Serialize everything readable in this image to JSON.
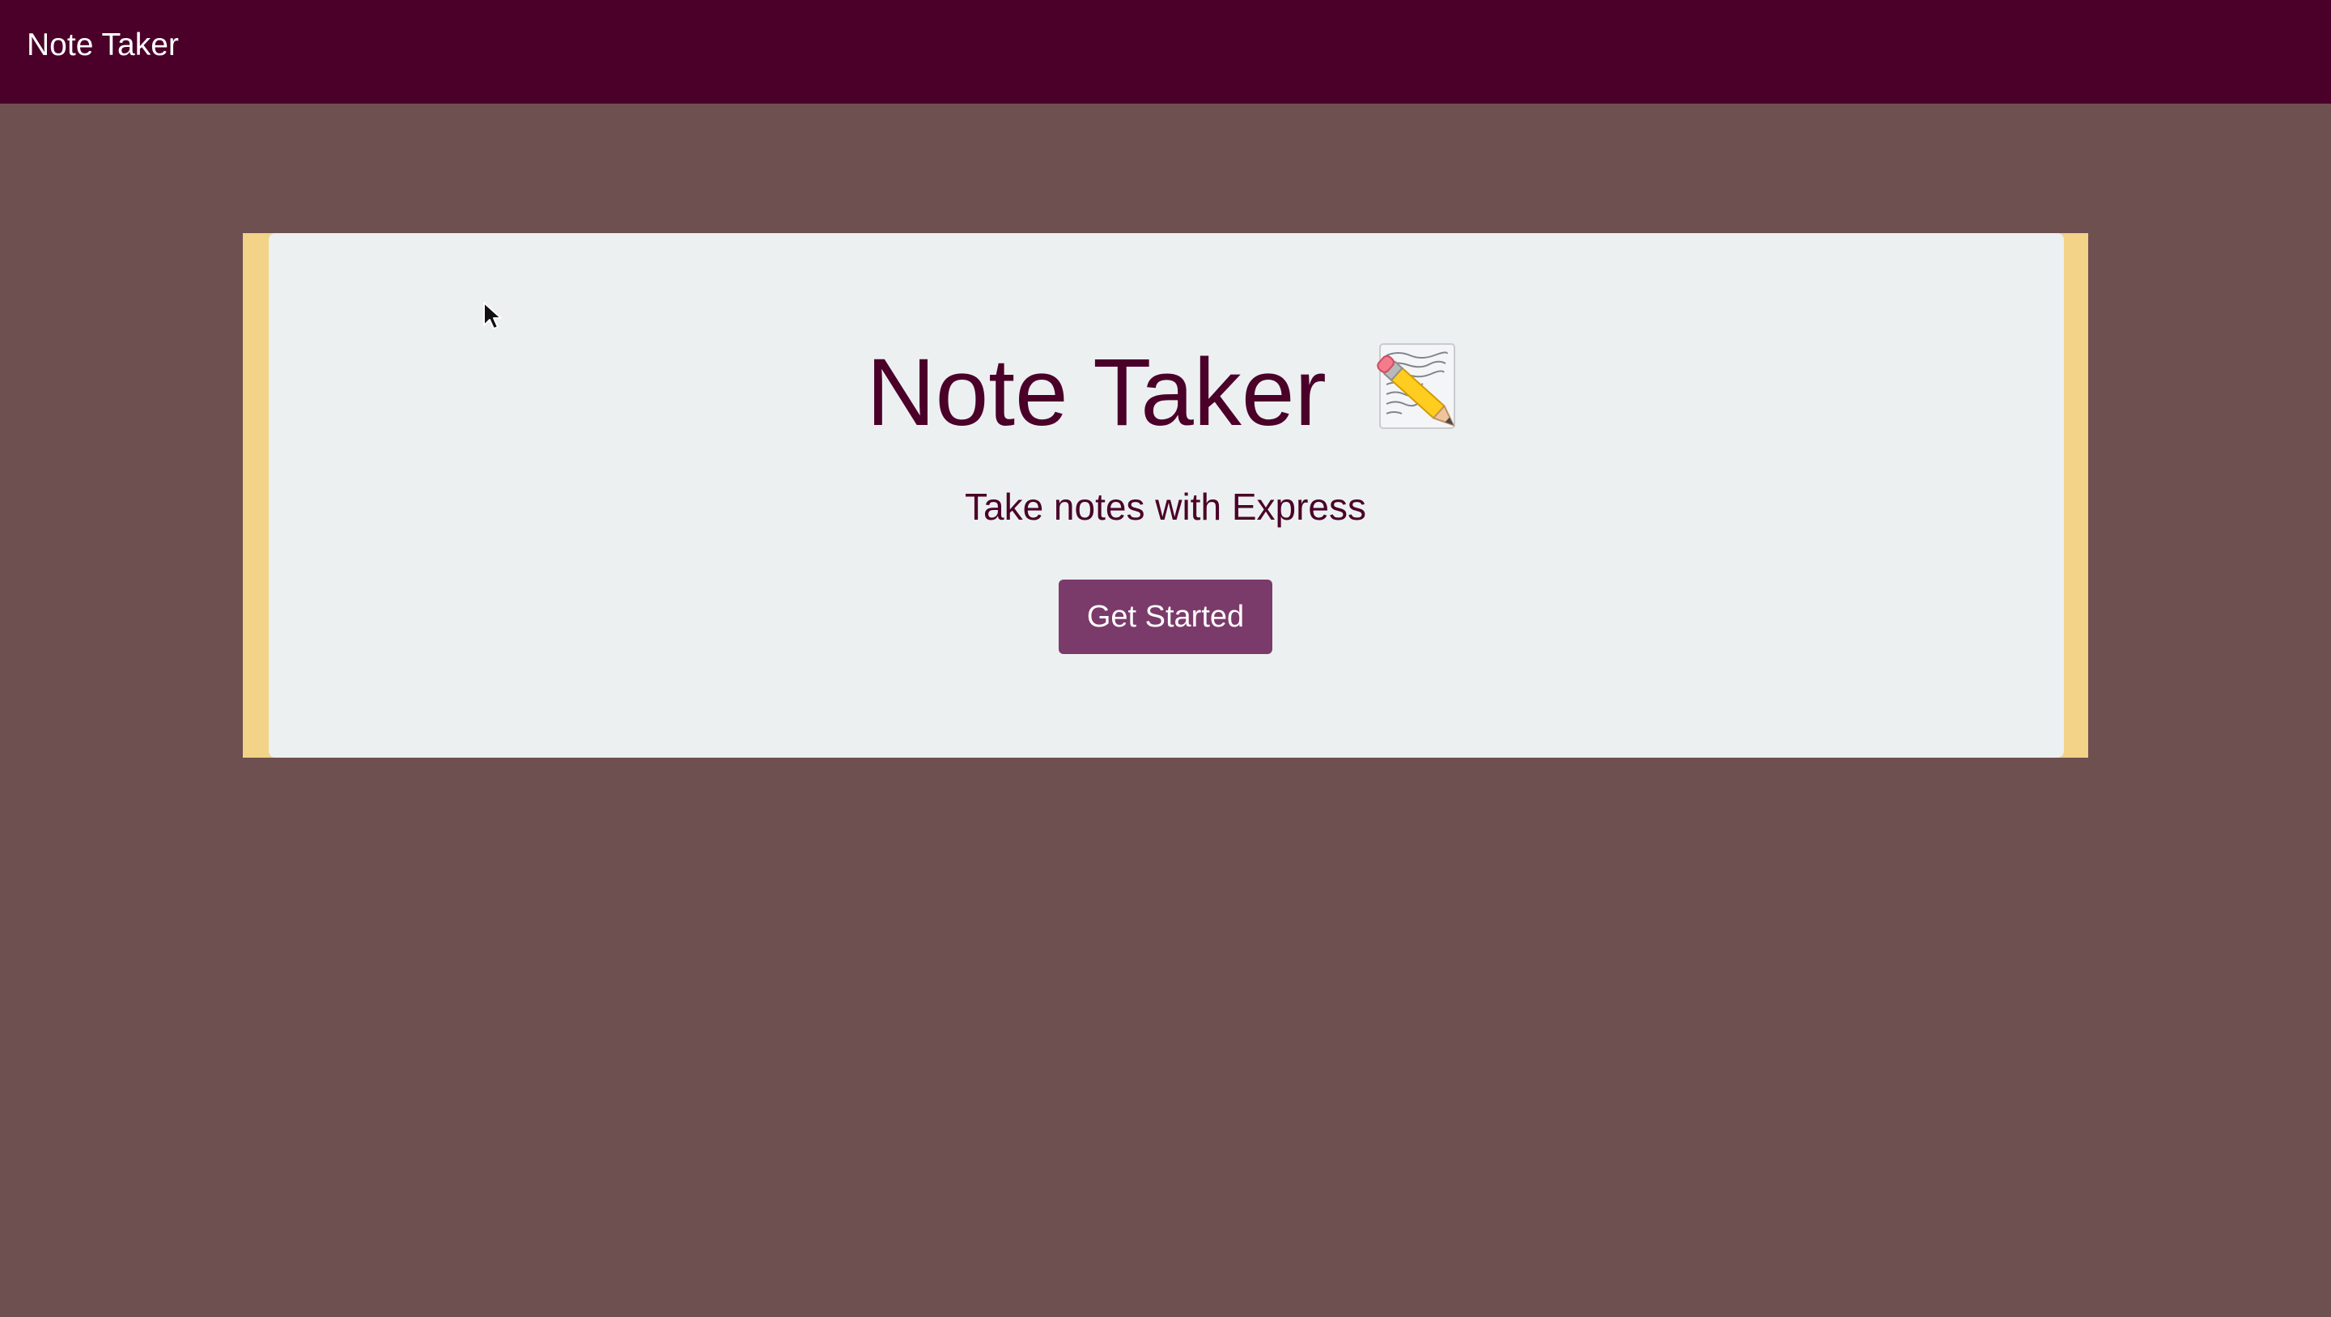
{
  "navbar": {
    "brand": "Note Taker"
  },
  "hero": {
    "title": "Note Taker",
    "title_icon": "memo-icon",
    "subtitle": "Take notes with Express",
    "button_label": "Get Started"
  },
  "colors": {
    "navbar_bg": "#4a0028",
    "page_bg": "#6f5050",
    "hero_bg": "#ecf0f1",
    "hero_border": "#f2d387",
    "title_text": "#4a0028",
    "button_bg": "#7b3b6a",
    "button_text": "#ffffff"
  },
  "icons": {
    "cursor": "mouse-pointer-icon"
  }
}
